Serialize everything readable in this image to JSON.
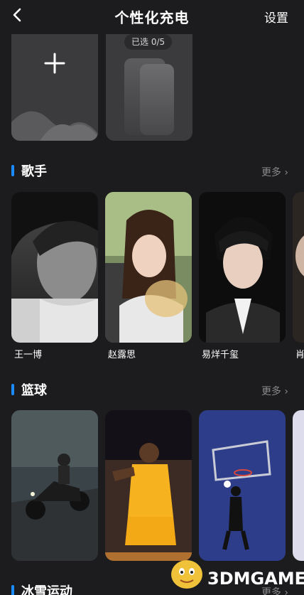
{
  "header": {
    "title": "个性化充电",
    "settings_label": "设置"
  },
  "custom": {
    "selected_badge": "已选 0/5"
  },
  "sections": [
    {
      "title": "歌手",
      "more_label": "更多 ›",
      "items": [
        {
          "name": "王一博"
        },
        {
          "name": "赵露思"
        },
        {
          "name": "易烊千玺"
        },
        {
          "name": "肖"
        }
      ]
    },
    {
      "title": "篮球",
      "more_label": "更多 ›",
      "items": [
        {
          "name": ""
        },
        {
          "name": ""
        },
        {
          "name": ""
        },
        {
          "name": ""
        }
      ]
    },
    {
      "title": "冰雪运动",
      "more_label": "更多 ›"
    }
  ],
  "watermark": {
    "text": "3DMGAME"
  },
  "colors": {
    "background": "#1c1c1e",
    "accent": "#1a8cff",
    "card": "#3b3b3d",
    "muted_text": "#8a8a8c"
  }
}
